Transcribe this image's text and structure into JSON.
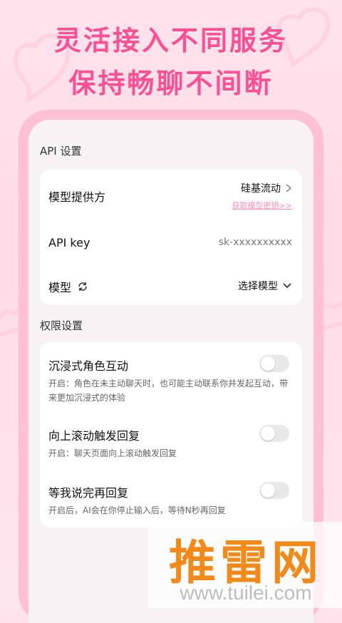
{
  "promo": {
    "line1": "灵活接入不同服务",
    "line2": "保持畅聊不间断"
  },
  "api_section": {
    "title": "API 设置",
    "provider": {
      "label": "模型提供方",
      "value": "硅基流动",
      "link": "获取模型密钥>>"
    },
    "api_key": {
      "label": "API key",
      "value": "sk-xxxxxxxxxx"
    },
    "model": {
      "label": "模型",
      "value": "选择模型"
    }
  },
  "permission_section": {
    "title": "权限设置",
    "items": [
      {
        "title": "沉浸式角色互动",
        "desc": "开启：角色在未主动聊天时，也可能主动联系你并发起互动，带来更加沉浸式的体验",
        "enabled": false
      },
      {
        "title": "向上滚动触发回复",
        "desc": "开启：聊天页面向上滚动触发回复",
        "enabled": false
      },
      {
        "title": "等我说完再回复",
        "desc": "开启后，AI会在你停止输入后，等待N秒再回复",
        "enabled": false
      }
    ]
  },
  "watermark": {
    "brand": "推雷网",
    "url": "www.tuilei.com"
  },
  "icons": [
    "chevron-right-icon",
    "refresh-icon",
    "chevron-down-icon",
    "heart-icon"
  ],
  "colors": {
    "accent": "#ff4f93",
    "phone_frame": "#ffbfd4",
    "link": "#ff8fb3",
    "watermark": "#f28a1a"
  }
}
